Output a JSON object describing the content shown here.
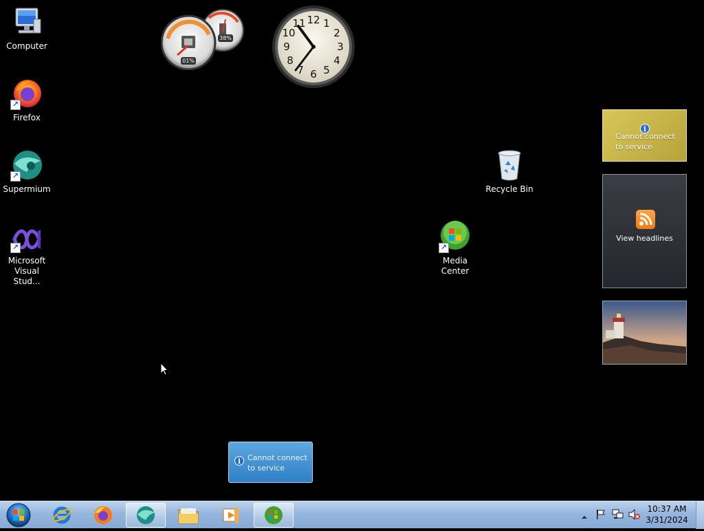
{
  "desktop": {
    "icons": [
      {
        "label": "Computer"
      },
      {
        "label": "Firefox"
      },
      {
        "label": "Supermium"
      },
      {
        "label": "Microsoft Visual Stud..."
      },
      {
        "label": "Recycle Bin"
      },
      {
        "label": "Media Center"
      }
    ]
  },
  "gadgets": {
    "cpu_meter": {
      "cpu": "01%",
      "memory": "38%"
    },
    "clock": {
      "numerals": [
        "12",
        "1",
        "2",
        "3",
        "4",
        "5",
        "6",
        "7",
        "8",
        "9",
        "10",
        "11"
      ]
    },
    "currency": {
      "message": "Cannot connect to service"
    },
    "feed": {
      "message": "View headlines"
    },
    "weather": {
      "message": "Cannot connect to service"
    }
  },
  "taskbar": {
    "buttons": [
      {
        "name": "internet-explorer"
      },
      {
        "name": "firefox"
      },
      {
        "name": "supermium"
      },
      {
        "name": "file-explorer"
      },
      {
        "name": "media-player"
      },
      {
        "name": "media-center"
      }
    ],
    "clock": {
      "time": "10:37 AM",
      "date": "3/31/2024"
    }
  },
  "colors": {
    "taskbar": "#96b6dd",
    "desktop": "#000000",
    "accent": "#2a6bd3"
  }
}
